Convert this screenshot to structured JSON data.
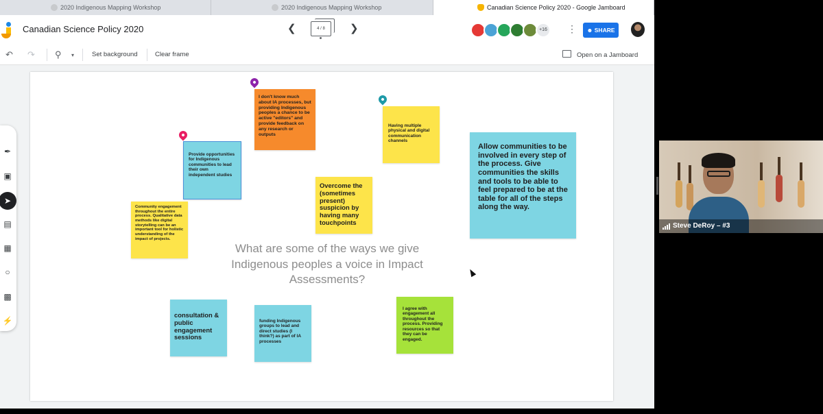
{
  "tabs": [
    {
      "title": "2020 Indigenous Mapping Workshop"
    },
    {
      "title": "2020 Indigenous Mapping Workshop"
    },
    {
      "title": "Canadian Science Policy 2020 - Google Jamboard"
    }
  ],
  "app": {
    "title": "Canadian Science Policy 2020",
    "frame_counter": "4 / 8",
    "collaborators_more": "+16",
    "share_label": "SHARE",
    "brand_color": "#1a73e8"
  },
  "toolbar": {
    "set_background": "Set background",
    "clear_frame": "Clear frame",
    "open_on_jamboard": "Open on a Jamboard"
  },
  "board": {
    "question": "What are some of the ways we give Indigenous peoples a voice in Impact Assessments?",
    "notes": [
      {
        "text": "I don't know much about IA processes, but providing Indigenous peoples a chance to be active \"editors\" and provide feedback on any research or outputs",
        "color": "orange"
      },
      {
        "text": "Having multiple physical and digital communication channels",
        "color": "yellow"
      },
      {
        "text": "Allow communities to be involved in every step of the process. Give communities the skills and tools to be able to feel prepared to be at the table for all of the steps along the way.",
        "color": "blue"
      },
      {
        "text": "Provide opportunities for Indigenous communities to lead their own independent studies",
        "color": "blue"
      },
      {
        "text": "Overcome the (sometimes present) suspicion by having many touchpoints",
        "color": "yellow"
      },
      {
        "text": "Community engagement throughout the entire process. Qualitative data methods like digital storytelling can be an important tool for holistic understanding of the impact of projects.",
        "color": "yellow"
      },
      {
        "text": "consultation & public engagement sessions",
        "color": "blue"
      },
      {
        "text": "funding Indigenous groups to lead and direct studies (I think?) as part of IA processes",
        "color": "blue"
      },
      {
        "text": "I agree with engagement all throughout the process. Providing resources so that they can be engaged.",
        "color": "green"
      }
    ]
  },
  "video": {
    "participant": "Steve DeRoy – #3"
  }
}
